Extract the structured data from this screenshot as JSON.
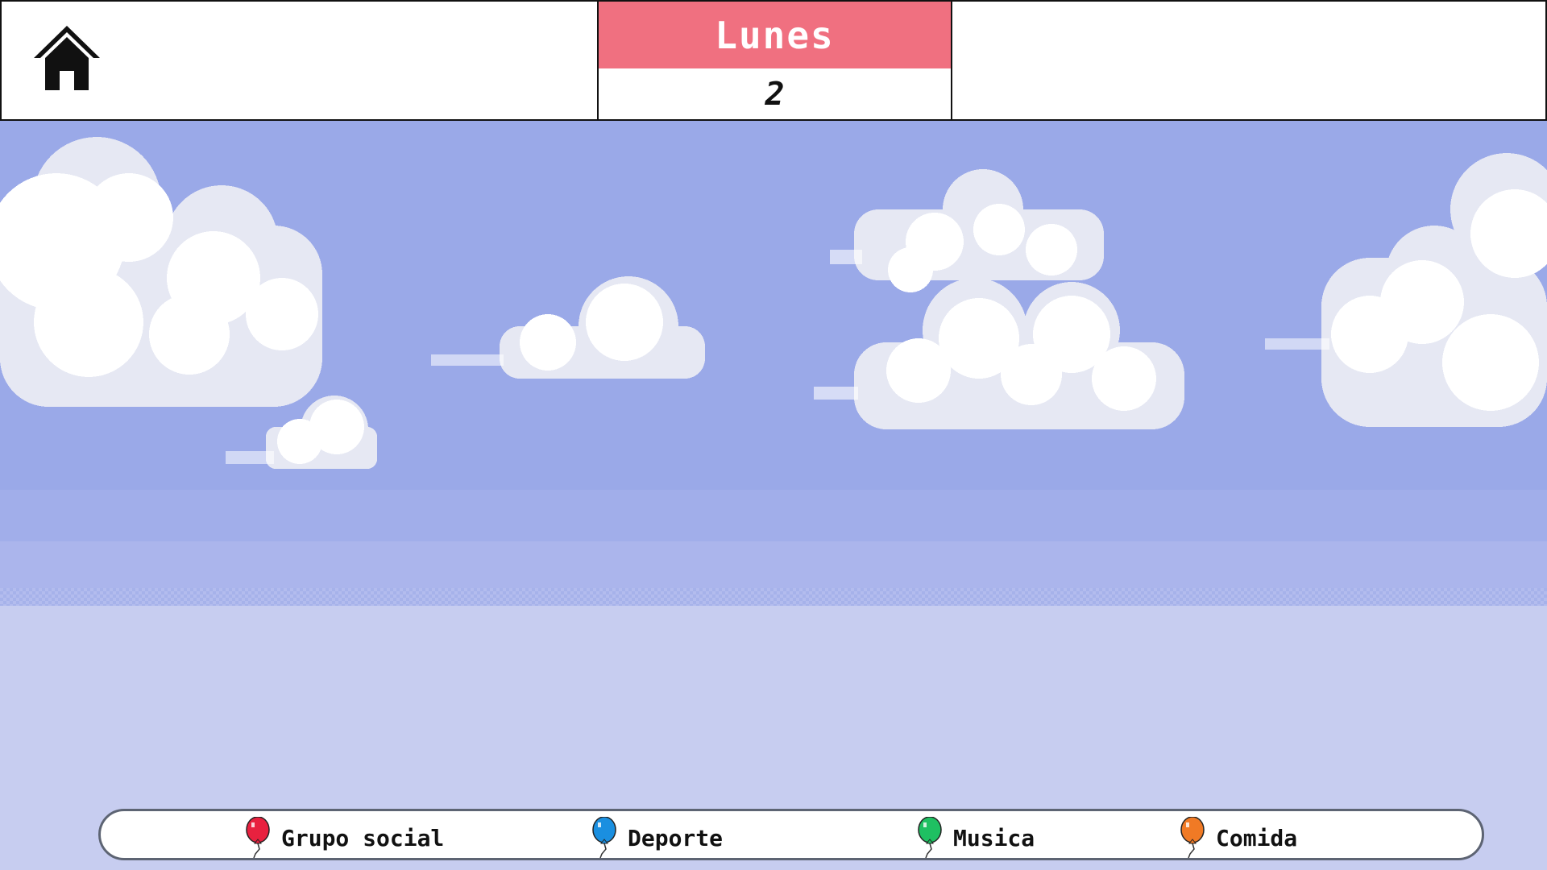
{
  "header": {
    "home_icon": "home-icon",
    "day_name": "Lunes",
    "day_number": "2",
    "day_color": "#f07080"
  },
  "scene": {
    "sky_color": "#9aa9e8",
    "horizon_color": "#a6b2ea",
    "ground_color": "#c7cdf0",
    "cloud_color": "#ffffff",
    "cloud_shade": "#e6e8f3"
  },
  "legend": {
    "items": [
      {
        "label": "Grupo social",
        "color": "#e8213f",
        "icon": "red-balloon-icon"
      },
      {
        "label": "Deporte",
        "color": "#1a8fe0",
        "icon": "blue-balloon-icon"
      },
      {
        "label": "Musica",
        "color": "#1fc062",
        "icon": "green-balloon-icon"
      },
      {
        "label": "Comida",
        "color": "#f07a25",
        "icon": "orange-balloon-icon"
      }
    ]
  }
}
